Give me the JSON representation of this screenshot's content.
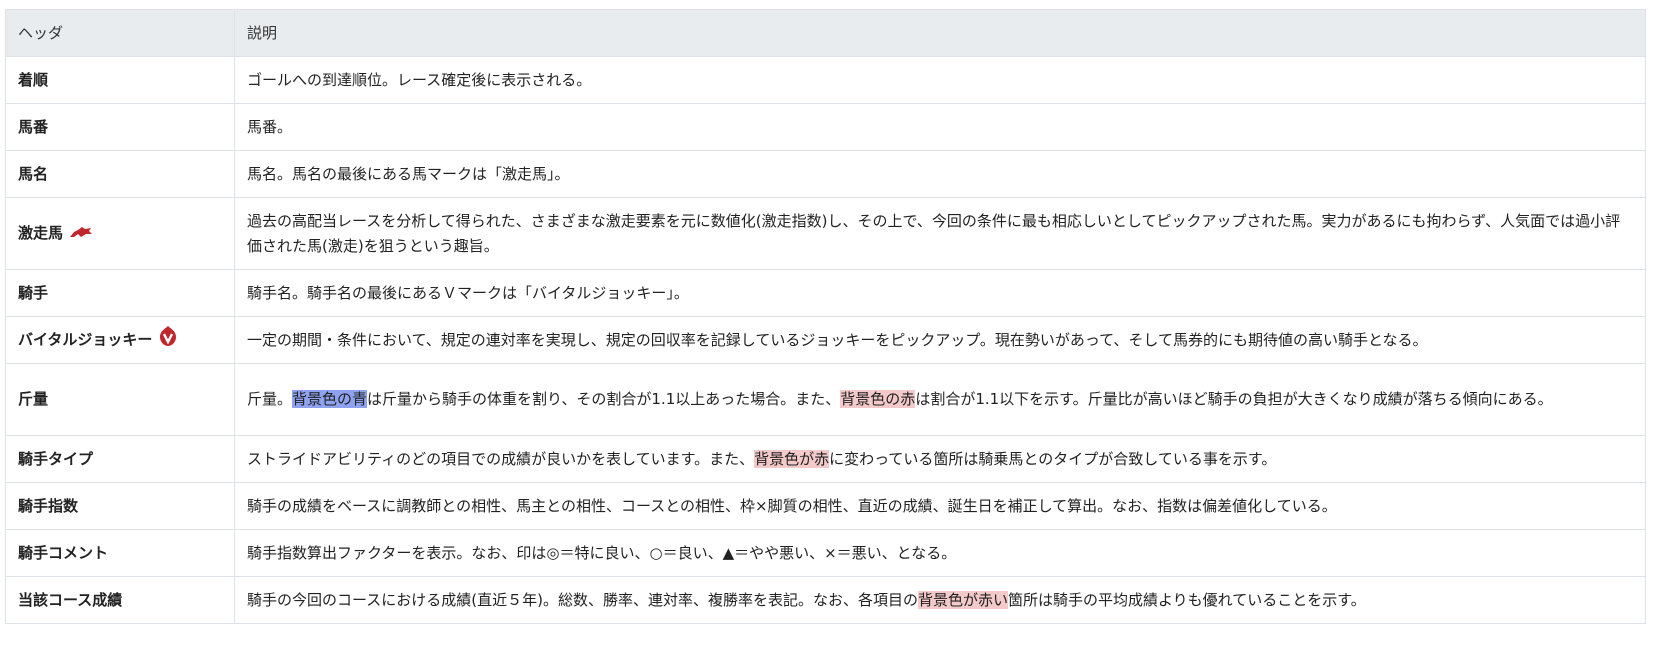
{
  "header": {
    "col1": "ヘッダ",
    "col2": "説明"
  },
  "rows": [
    {
      "name": "着順",
      "desc": "ゴールへの到達順位。レース確定後に表示される。"
    },
    {
      "name": "馬番",
      "desc": "馬番。"
    },
    {
      "name": "馬名",
      "desc": "馬名。馬名の最後にある馬マークは「激走馬」。"
    },
    {
      "name": "激走馬",
      "icon": "horse-mark-icon",
      "desc": "過去の高配当レースを分析して得られた、さまざまな激走要素を元に数値化(激走指数)し、その上で、今回の条件に最も相応しいとしてピックアップされた馬。実力があるにも拘わらず、人気面では過小評価された馬(激走)を狙うという趣旨。"
    },
    {
      "name": "騎手",
      "desc": "騎手名。騎手名の最後にあるＶマークは「バイタルジョッキー」。"
    },
    {
      "name": "バイタルジョッキー",
      "icon": "vital-v-icon",
      "desc": "一定の期間・条件において、規定の連対率を実現し、規定の回収率を記録しているジョッキーをピックアップ。現在勢いがあって、そして馬券的にも期待値の高い騎手となる。"
    },
    {
      "name": "斤量",
      "desc_parts": [
        "斤量。",
        "背景色の青",
        "は斤量から騎手の体重を割り、その割合が1.1以上あった場合。また、",
        "背景色の赤",
        "は割合が1.1以下を示す。斤量比が高いほど騎手の負担が大きくなり成績が落ちる傾向にある。"
      ]
    },
    {
      "name": "騎手タイプ",
      "desc_parts": [
        "ストライドアビリティのどの項目での成績が良いかを表しています。また、",
        "背景色が赤",
        "に変わっている箇所は騎乗馬とのタイプが合致している事を示す。"
      ]
    },
    {
      "name": "騎手指数",
      "desc": "騎手の成績をベースに調教師との相性、馬主との相性、コースとの相性、枠×脚質の相性、直近の成績、誕生日を補正して算出。なお、指数は偏差値化している。"
    },
    {
      "name": "騎手コメント",
      "desc": "騎手指数算出ファクターを表示。なお、印は◎＝特に良い、○＝良い、▲＝やや悪い、×＝悪い、となる。"
    },
    {
      "name": "当該コース成績",
      "desc_parts": [
        "騎手の今回のコースにおける成績(直近５年)。総数、勝率、連対率、複勝率を表記。なお、各項目の",
        "背景色が赤い",
        "箇所は騎手の平均成績よりも優れていることを示す。"
      ]
    }
  ],
  "colors": {
    "header_bg": "#e9ecef",
    "border": "#dee2e6",
    "highlight_blue": "#8ea2f0",
    "highlight_red": "#f3c9c9",
    "icon_red": "#c0272d"
  }
}
